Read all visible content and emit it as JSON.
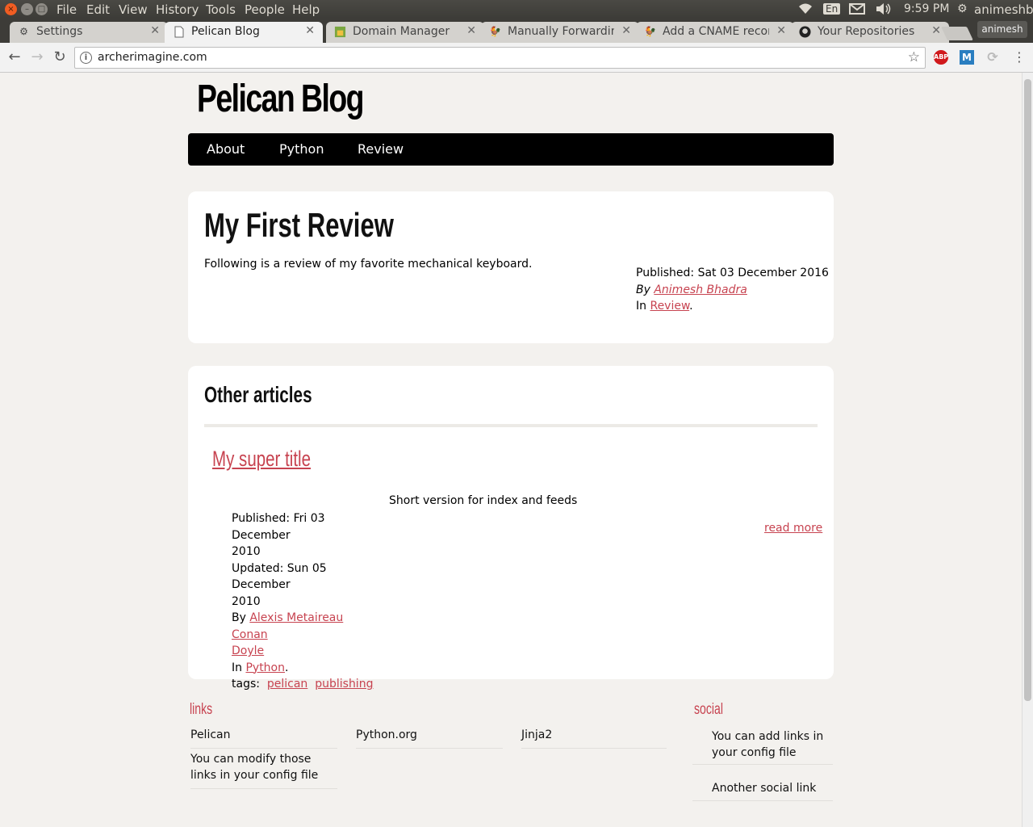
{
  "os": {
    "menus": [
      "File",
      "Edit",
      "View",
      "History",
      "Tools",
      "People",
      "Help"
    ],
    "input_lang": "En",
    "time": "9:59 PM",
    "user": "animeshb"
  },
  "browser": {
    "tabs": [
      {
        "title": "Settings",
        "icon": "gear-icon"
      },
      {
        "title": "Pelican Blog",
        "icon": "page-icon"
      },
      {
        "title": "Domain Manager",
        "icon": "domain-icon"
      },
      {
        "title": "Manually Forwarding",
        "icon": "bird-icon"
      },
      {
        "title": "Add a CNAME record",
        "icon": "bird-icon"
      },
      {
        "title": "Your Repositories",
        "icon": "github-icon"
      }
    ],
    "profile": "animesh",
    "url": "archerimagine.com",
    "extensions": [
      "ABP",
      "M"
    ]
  },
  "site": {
    "title": "Pelican Blog",
    "nav": [
      "About",
      "Python",
      "Review"
    ]
  },
  "article": {
    "title": "My First Review",
    "summary": "Following is a review of my favorite mechanical keyboard.",
    "published": "Published: Sat 03 December 2016",
    "by": "By",
    "author": "Animesh Bhadra",
    "in": "In",
    "category": "Review"
  },
  "others": {
    "heading": "Other articles",
    "post": {
      "title": "My super title",
      "summary": "Short version for index and feeds",
      "published_1": "Published: Fri 03 December",
      "published_2": "2010",
      "updated_1": "Updated: Sun 05 December",
      "updated_2": "2010",
      "by": "By",
      "author_1": "Alexis Metaireau",
      "author_2a": "Conan",
      "author_2b": "Doyle",
      "in": "In",
      "category": "Python",
      "tags_label": "tags:",
      "tags": [
        "pelican",
        "publishing"
      ],
      "read_more": "read more"
    }
  },
  "footer": {
    "links_heading": "links",
    "links": [
      "Pelican",
      "Python.org",
      "Jinja2",
      "You can modify those links in your config file"
    ],
    "social_heading": "social",
    "social": [
      "You can add links in your config file",
      "Another social link"
    ]
  },
  "colors": {
    "accent": "#c74350",
    "nav_bg": "#000000",
    "page_bg": "#f3f1ee"
  }
}
